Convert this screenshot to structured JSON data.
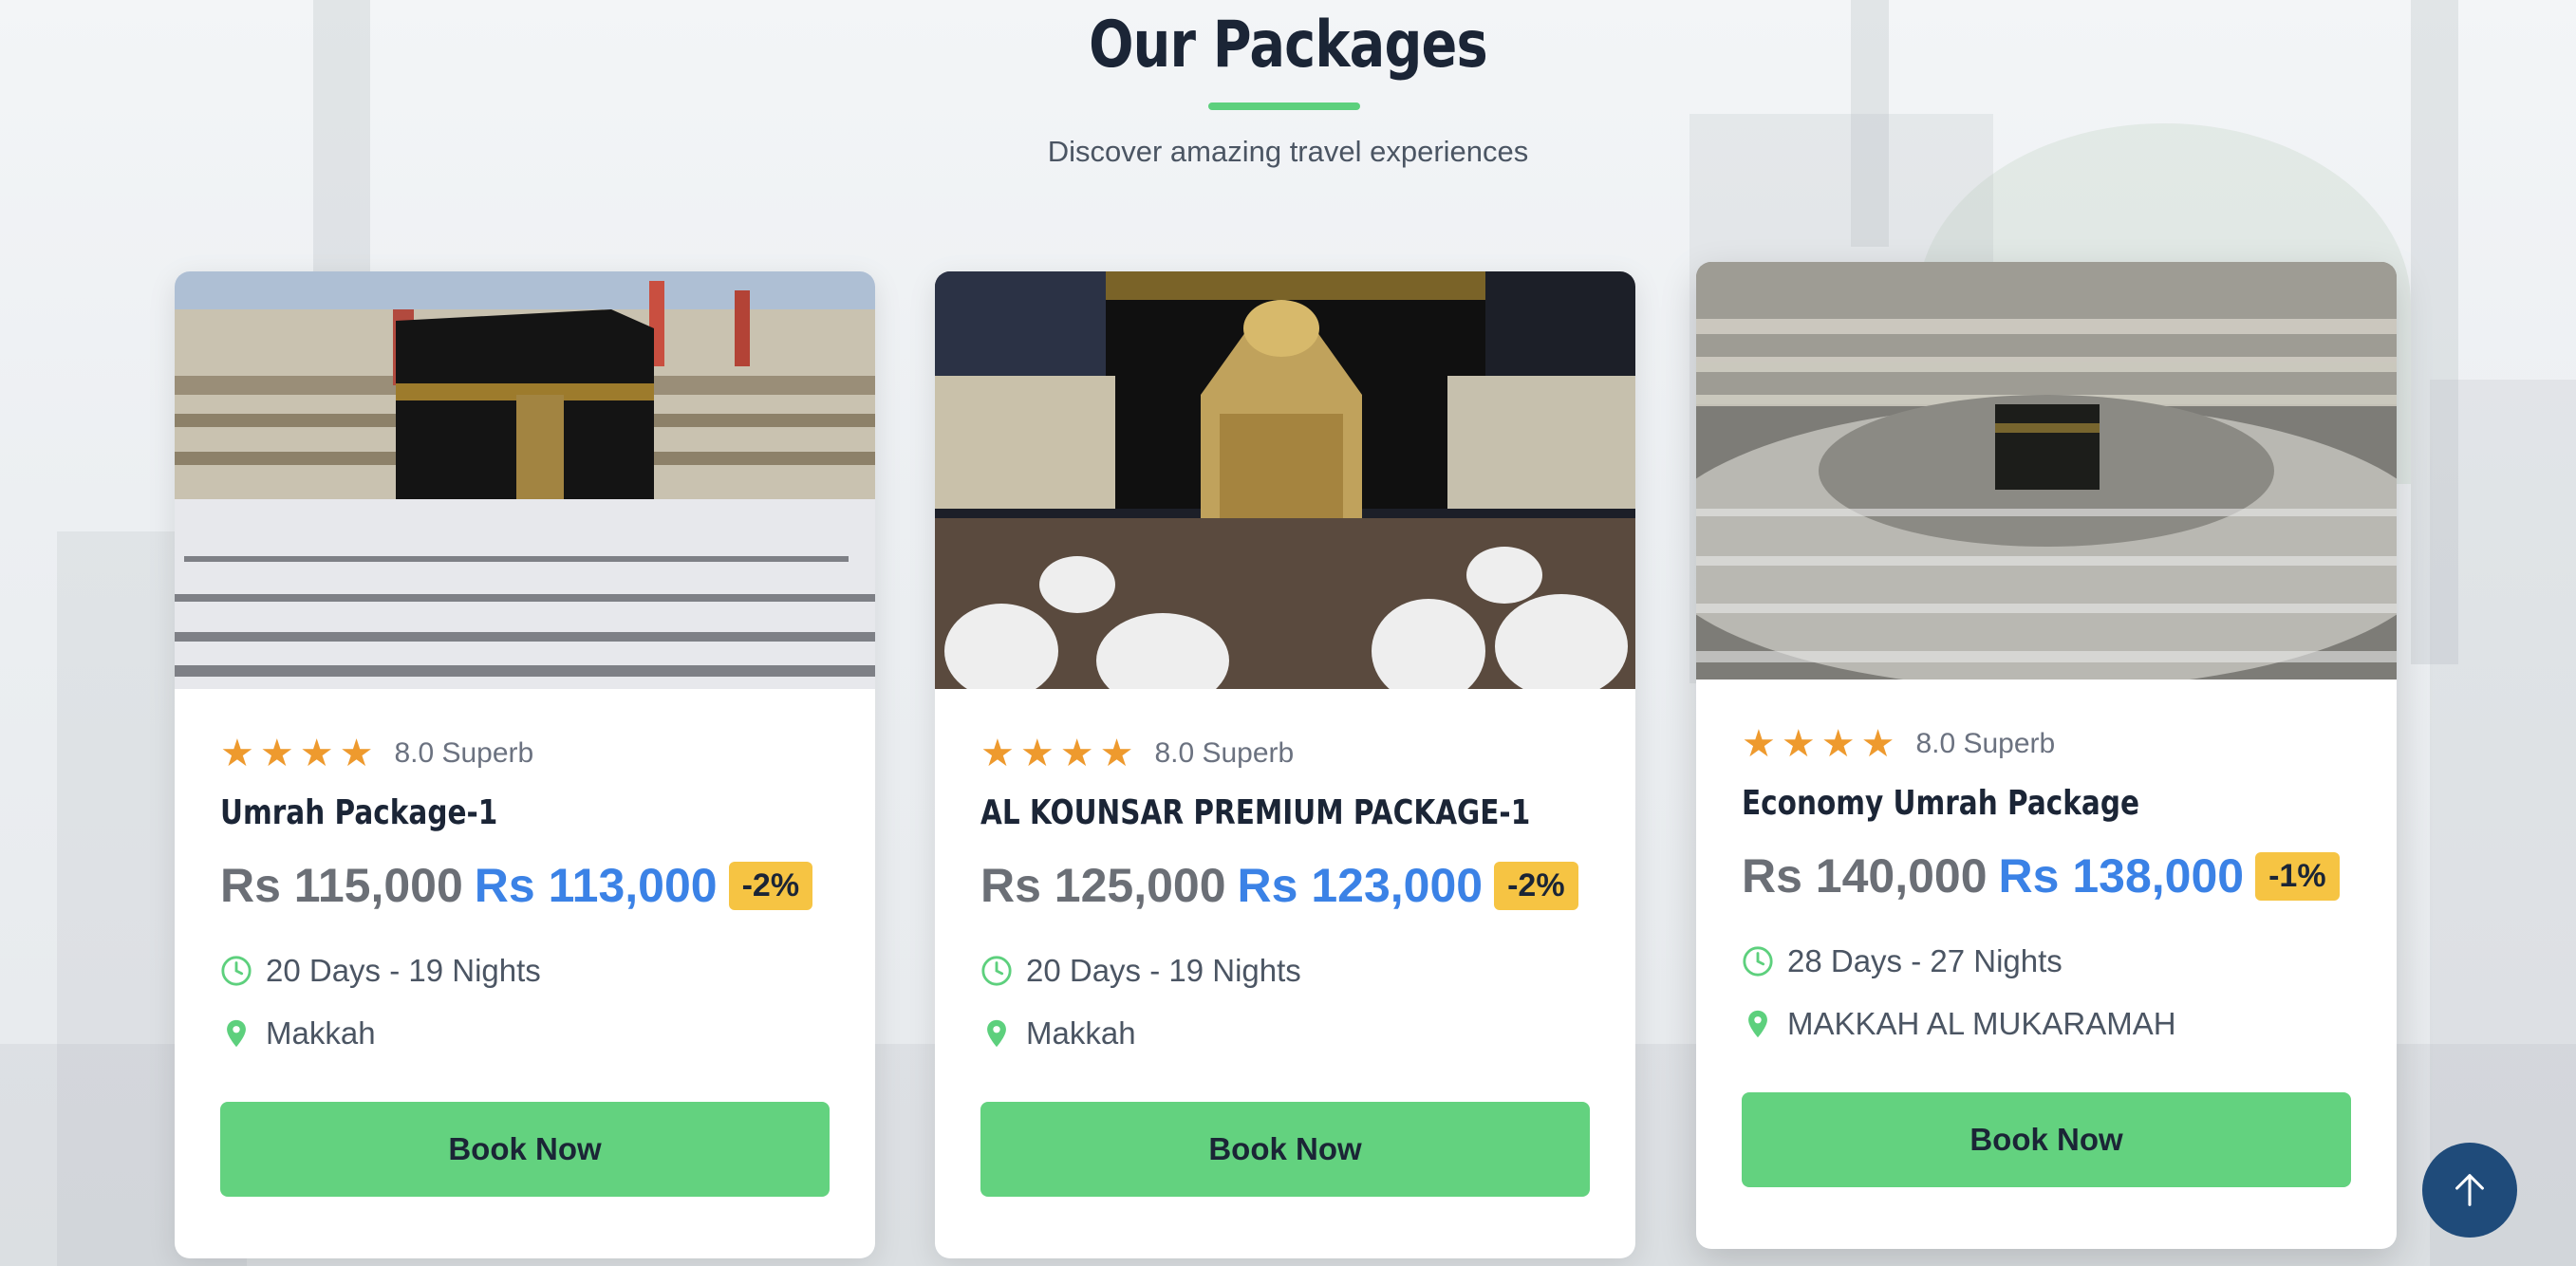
{
  "section": {
    "title": "Our Packages",
    "subtitle": "Discover amazing travel experiences"
  },
  "colors": {
    "accent_green": "#63d27f",
    "price_blue": "#3b82e6",
    "discount_yellow": "#f6c443",
    "star_orange": "#ee9a2e",
    "heading_dark": "#1b2536",
    "scroll_button": "#1f4b7a"
  },
  "cards": [
    {
      "image_icon": "kaaba-photo",
      "rating_stars": 4,
      "rating_text": "8.0 Superb",
      "title": "Umrah Package-1",
      "old_price": "Rs 115,000",
      "new_price": "Rs 113,000",
      "discount": "-2%",
      "duration": "20 Days - 19 Nights",
      "location": "Makkah",
      "button": "Book Now"
    },
    {
      "image_icon": "maqam-ibrahim-photo",
      "rating_stars": 4,
      "rating_text": "8.0 Superb",
      "title": "AL KOUNSAR PREMIUM PACKAGE-1",
      "old_price": "Rs 125,000",
      "new_price": "Rs 123,000",
      "discount": "-2%",
      "duration": "20 Days - 19 Nights",
      "location": "Makkah",
      "button": "Book Now"
    },
    {
      "image_icon": "masjid-al-haram-photo",
      "rating_stars": 4,
      "rating_text": "8.0 Superb",
      "title": "Economy Umrah Package",
      "old_price": "Rs 140,000",
      "new_price": "Rs 138,000",
      "discount": "-1%",
      "duration": "28 Days - 27 Nights",
      "location": "MAKKAH AL MUKARAMAH",
      "button": "Book Now"
    }
  ],
  "scroll_top": {
    "icon": "arrow-up-icon"
  }
}
